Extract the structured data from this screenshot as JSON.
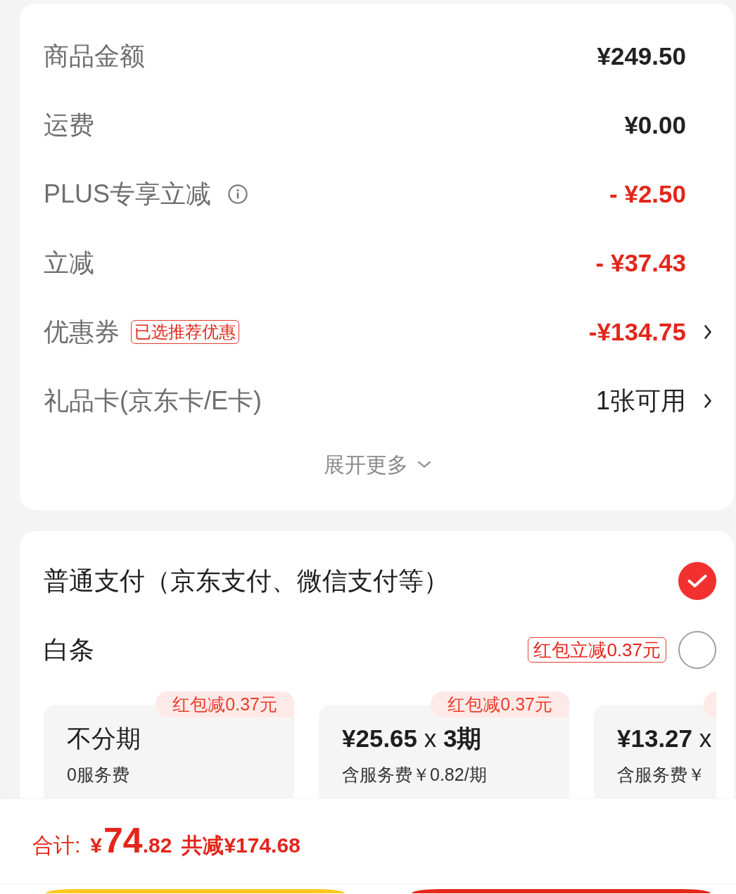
{
  "summary": {
    "rows": [
      {
        "label": "商品金额",
        "value": "¥249.50",
        "kind": "amount",
        "info_icon": false,
        "chevron": false
      },
      {
        "label": "运费",
        "value": "¥0.00",
        "kind": "amount",
        "info_icon": false,
        "chevron": false
      },
      {
        "label": "PLUS专享立减",
        "value": "- ¥2.50",
        "kind": "discount",
        "info_icon": true,
        "chevron": false
      },
      {
        "label": "立减",
        "value": "- ¥37.43",
        "kind": "discount",
        "info_icon": false,
        "chevron": false
      },
      {
        "label": "优惠券",
        "badge": "已选推荐优惠",
        "value": "-¥134.75",
        "kind": "discount",
        "info_icon": false,
        "chevron": true
      },
      {
        "label": "礼品卡(京东卡/E卡)",
        "value": "1张可用",
        "kind": "count",
        "info_icon": false,
        "chevron": true
      }
    ],
    "expand": {
      "label": "展开更多"
    }
  },
  "payment": {
    "options": [
      {
        "label": "普通支付（京东支付、微信支付等）",
        "selected": true
      },
      {
        "label": "白条",
        "badge": "红包立减0.37元",
        "selected": false
      }
    ],
    "installments": [
      {
        "title": "不分期",
        "subtitle": "0服务费",
        "tag": "红包减0.37元"
      },
      {
        "title": "**¥25.65** x **3期**",
        "subtitle": "含服务费￥0.82/期",
        "tag": "红包减0.37元"
      },
      {
        "title": "**¥13.27** x",
        "subtitle": "含服务费￥",
        "tag_edge": true
      }
    ]
  },
  "footer": {
    "total_label": "合计:",
    "total_price": {
      "symbol": "¥",
      "integer": "74",
      "fraction": ".82"
    },
    "saving": "共减¥174.68"
  }
}
